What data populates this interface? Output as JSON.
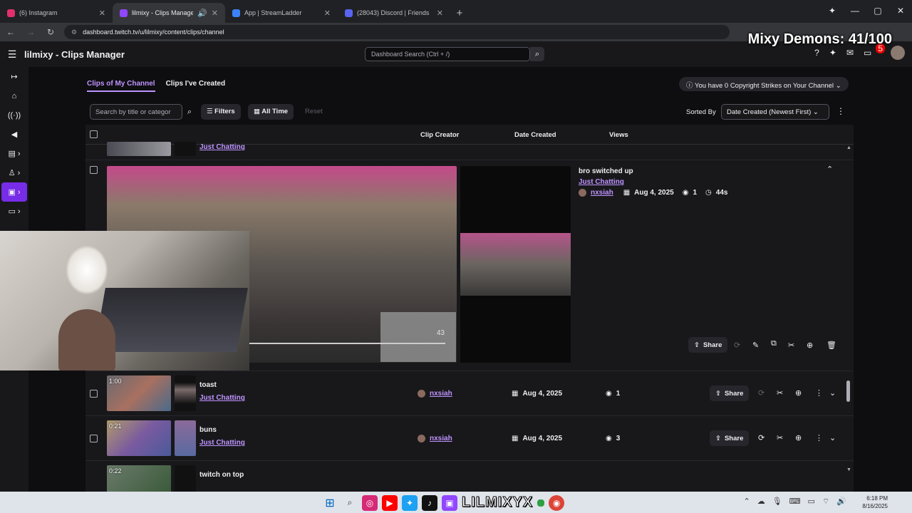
{
  "browser": {
    "tabs": [
      {
        "title": "(6) Instagram",
        "color": "#e1306c"
      },
      {
        "title": "lilmixy - Clips Manager - Tw",
        "color": "#9146ff"
      },
      {
        "title": "App | StreamLadder",
        "color": "#3b82f6"
      },
      {
        "title": "(28043) Discord | Friends",
        "color": "#5865f2"
      }
    ],
    "url": "dashboard.twitch.tv/u/lilmixy/content/clips/channel"
  },
  "overlay": {
    "title": "Mixy Demons: 41/100"
  },
  "app": {
    "title": "lilmixy - Clips Manager",
    "search_placeholder": "Dashboard Search (Ctrl + /)",
    "notif_count": "5"
  },
  "tabs": {
    "mine": "Clips of My Channel",
    "created": "Clips I've Created"
  },
  "strikes": "You have 0 Copyright Strikes on Your Channel",
  "toolbar": {
    "search_placeholder": "Search by title or categor",
    "filters": "Filters",
    "time": "All Time",
    "reset": "Reset",
    "sorted_by": "Sorted By",
    "sort_value": "Date Created (Newest First)"
  },
  "table": {
    "headers": {
      "creator": "Clip Creator",
      "date": "Date Created",
      "views": "Views"
    },
    "partial_top": {
      "game": "Just Chatting"
    },
    "expanded": {
      "title": "bro switched up",
      "game": "Just Chatting",
      "creator": "nxsiah",
      "date": "Aug 4, 2025",
      "views": "1",
      "duration": "44s",
      "share": "Share",
      "overlay_count": "43"
    },
    "rows": [
      {
        "duration": "1:00",
        "title": "toast",
        "game": "Just Chatting",
        "creator": "nxsiah",
        "date": "Aug 4, 2025",
        "views": "1",
        "share": "Share"
      },
      {
        "duration": "0:21",
        "title": "buns",
        "game": "Just Chatting",
        "creator": "nxsiah",
        "date": "Aug 4, 2025",
        "views": "3",
        "share": "Share"
      },
      {
        "duration": "0:22",
        "title": "twitch on top"
      }
    ]
  },
  "taskbar": {
    "brand": "LILMIXYX",
    "time": "6:18 PM",
    "date": "8/16/2025"
  }
}
